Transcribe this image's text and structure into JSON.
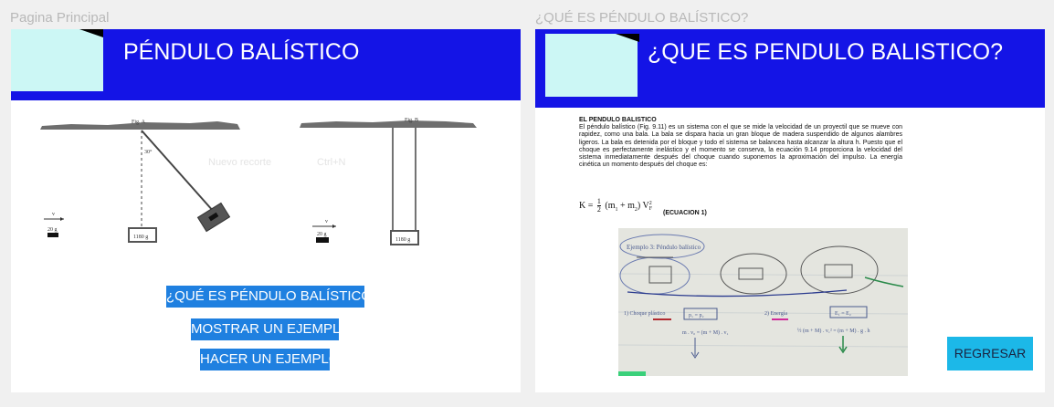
{
  "frames": {
    "left_label": "Pagina Principal",
    "right_label": "¿QUÉ ES PÉNDULO BALÍSTICO?"
  },
  "main": {
    "title": "PÉNDULO BALÍSTICO",
    "buttons": {
      "what_is": "¿QUÉ ES PÉNDULO BALÍSTICO?",
      "show_example": "MOSTRAR UN EJEMPLO",
      "do_example": "HACER UN EJEMPLO"
    },
    "ghost": {
      "new_snip": "Nuevo recorte",
      "shortcut": "Ctrl+N"
    },
    "figure": {
      "fig_a": "Fig. A",
      "fig_b": "Fig. B",
      "angle": "30°",
      "v": "v",
      "mass_bullet": "20 g",
      "mass_block": "1180 g"
    }
  },
  "detail": {
    "title": "¿QUE ES PENDULO BALISTICO?",
    "doc_title": "EL PENDULO BALISTICO",
    "doc_body": "El péndulo balístico (Fig. 9.11) es un sistema con el que se mide la velocidad de un proyectil que se mueve con rapidez, como una bala. La bala se dispara hacia un gran bloque de madera suspendido de algunos alambres ligeros. La bala es detenida por el bloque y todo el sistema se balancea hasta alcanzar la altura h. Puesto que el choque es perfectamente inelástico y el momento se conserva, la ecuación 9.14 proporciona la velocidad del sistema inmediatamente después del choque cuando suponemos la aproximación del impulso. La energía cinética un momento después del choque es:",
    "formula": {
      "lhs": "K =",
      "frac_num": "1",
      "frac_den": "2",
      "mid": "(m",
      "sub1": "1",
      "plus": " + m",
      "sub2": "2",
      "close": ") V",
      "sup": "2",
      "subF": "F"
    },
    "equation_label": "(ECUACION 1)",
    "photo": {
      "bubble": "Ejemplo 3: Péndulo balístico",
      "choque": "1) Choque plástico",
      "energia": "2) Energía",
      "p_eq": "p₁ = p₂",
      "e_eq": "E₁ = E₂",
      "mom_eq": "m . v₀ = (m + M) . v₁",
      "en_eq": "½ (m + M) . v₁² = (m + M) . g . h"
    },
    "back_button": "REGRESAR"
  }
}
